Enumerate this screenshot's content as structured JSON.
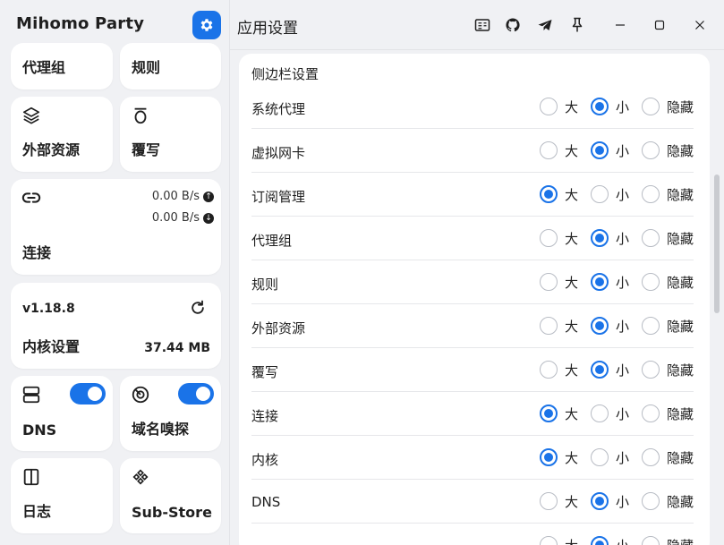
{
  "sidebar": {
    "app_title": "Mihomo Party",
    "cards": {
      "proxy_group": "代理组",
      "rules": "规则",
      "external_resources": "外部资源",
      "override": "覆写",
      "connections": {
        "label": "连接",
        "upload": "0.00 B/s",
        "download": "0.00 B/s"
      },
      "core": {
        "version": "v1.18.8",
        "label": "内核设置",
        "memory": "37.44 MB"
      },
      "dns": "DNS",
      "sniff": "域名嗅探",
      "logs": "日志",
      "substore": "Sub-Store"
    }
  },
  "main": {
    "title": "应用设置",
    "section_title": "侧边栏设置",
    "options": [
      "大",
      "小",
      "隐藏"
    ],
    "rows": [
      {
        "name": "系统代理",
        "selected": 1
      },
      {
        "name": "虚拟网卡",
        "selected": 1
      },
      {
        "name": "订阅管理",
        "selected": 0
      },
      {
        "name": "代理组",
        "selected": 1
      },
      {
        "name": "规则",
        "selected": 1
      },
      {
        "name": "外部资源",
        "selected": 1
      },
      {
        "name": "覆写",
        "selected": 1
      },
      {
        "name": "连接",
        "selected": 0
      },
      {
        "name": "内核",
        "selected": 0
      },
      {
        "name": "DNS",
        "selected": 1
      },
      {
        "name": "",
        "selected": 1
      }
    ]
  },
  "colors": {
    "accent": "#1a73e8",
    "background": "#f0f1f4",
    "card": "#ffffff"
  }
}
